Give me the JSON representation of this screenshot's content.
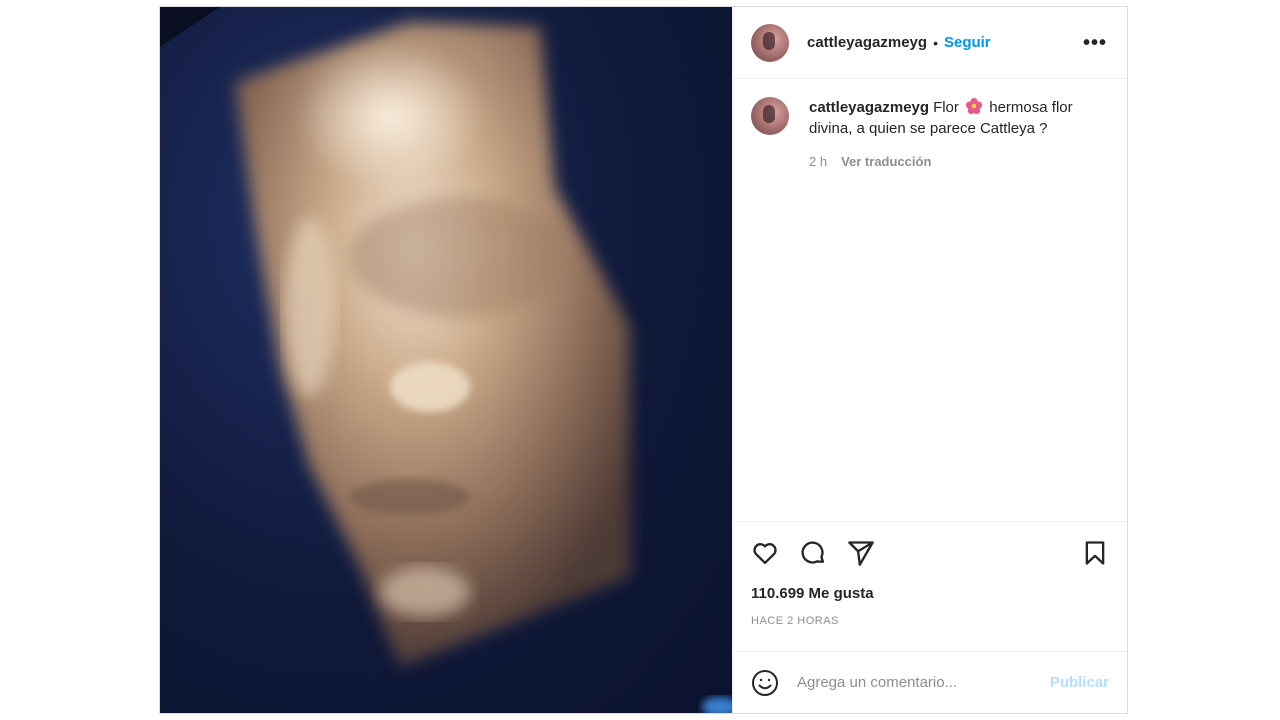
{
  "post": {
    "author": "cattleyagazmeyg",
    "separator": "•",
    "follow_label": "Seguir",
    "more_label": "•••",
    "media_icon": "ultrasound-photo"
  },
  "caption": {
    "username": "cattleyagazmeyg",
    "text_before": "Flor",
    "emoji": "hibiscus-emoji",
    "text_after": "hermosa flor divina, a quien se parece Cattleya ?",
    "age": "2 h",
    "translate_label": "Ver traducción"
  },
  "actions": {
    "like_icon": "heart-icon",
    "comment_icon": "comment-icon",
    "share_icon": "share-icon",
    "save_icon": "bookmark-icon"
  },
  "likes": "110.699 Me gusta",
  "timestamp": "HACE 2 HORAS",
  "add_comment": {
    "placeholder": "Agrega un comentario...",
    "publish_label": "Publicar"
  },
  "colors": {
    "accent": "#0095f6",
    "publish_disabled": "#b2dffc",
    "muted": "#8e8e8e",
    "text": "#262626"
  }
}
